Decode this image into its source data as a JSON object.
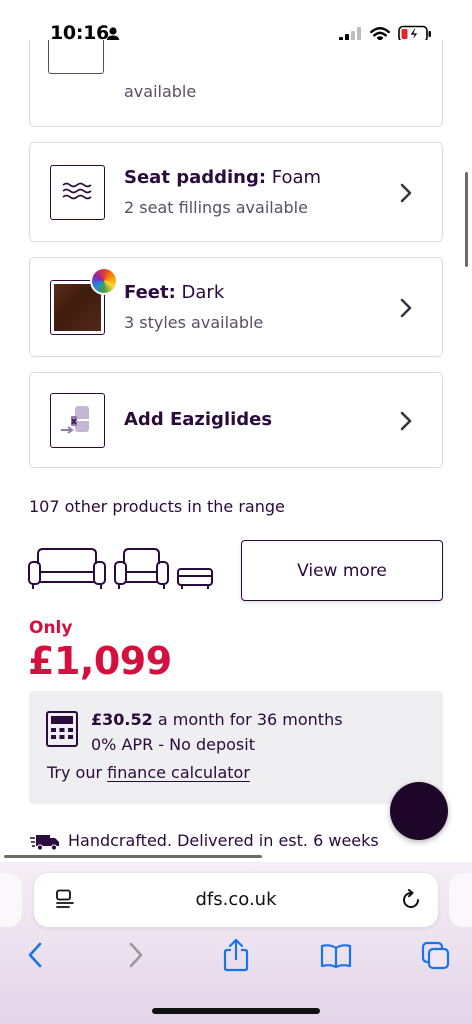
{
  "status_bar": {
    "time": "10:16"
  },
  "options": {
    "partial_sub": "available",
    "seat_padding": {
      "label": "Seat padding:",
      "value": "Foam",
      "sub": "2 seat fillings available"
    },
    "feet": {
      "label": "Feet:",
      "value": "Dark",
      "sub": "3 styles available"
    },
    "eaziglides": {
      "label": "Add Eaziglides"
    }
  },
  "range": {
    "text": "107 other products in the range",
    "view_more": "View more"
  },
  "price": {
    "only": "Only",
    "amount": "£1,099"
  },
  "finance": {
    "monthly": "£30.52",
    "monthly_rest": "a month for 36 months",
    "apr": "0% APR - No deposit",
    "try_our": "Try our",
    "calculator_link": "finance calculator"
  },
  "delivery": {
    "text": "Handcrafted. Delivered in est. 6 weeks"
  },
  "browser": {
    "url": "dfs.co.uk"
  },
  "colors": {
    "brand_purple": "#2b0a3d",
    "price_red": "#d4103e",
    "feet_swatch": "#4a2414"
  }
}
